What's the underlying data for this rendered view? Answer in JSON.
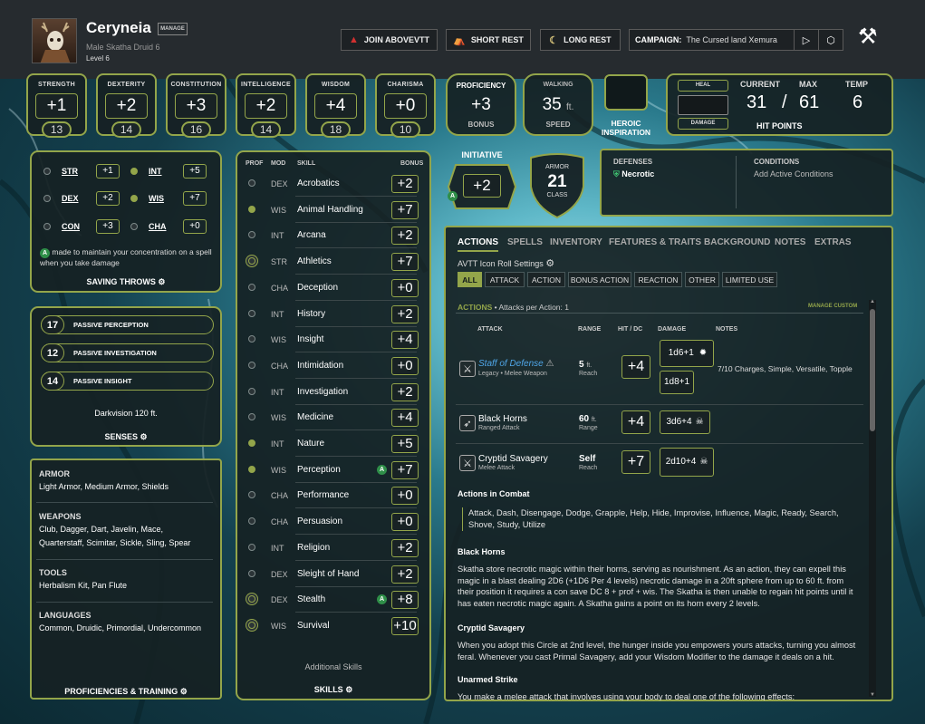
{
  "header": {
    "name": "Ceryneia",
    "manage": "MANAGE",
    "sub": "Male  Skatha  Druid 6",
    "level": "Level 6",
    "join": "JOIN ABOVEVTT",
    "short_rest": "SHORT REST",
    "long_rest": "LONG REST",
    "campaign_label": "CAMPAIGN:",
    "campaign": "The Cursed land Xemura"
  },
  "abilities": [
    {
      "name": "STRENGTH",
      "mod": "+1",
      "score": "13"
    },
    {
      "name": "DEXTERITY",
      "mod": "+2",
      "score": "14"
    },
    {
      "name": "CONSTITUTION",
      "mod": "+3",
      "score": "16"
    },
    {
      "name": "INTELLIGENCE",
      "mod": "+2",
      "score": "14"
    },
    {
      "name": "WISDOM",
      "mod": "+4",
      "score": "18"
    },
    {
      "name": "CHARISMA",
      "mod": "+0",
      "score": "10"
    }
  ],
  "proficiency": {
    "label": "PROFICIENCY",
    "value": "+3",
    "sub": "BONUS"
  },
  "walking": {
    "label": "WALKING",
    "value": "35",
    "unit": "ft.",
    "sub": "SPEED"
  },
  "inspiration": {
    "line1": "HEROIC",
    "line2": "INSPIRATION"
  },
  "hp": {
    "heal": "HEAL",
    "damage": "DAMAGE",
    "current_label": "CURRENT",
    "max_label": "MAX",
    "temp_label": "TEMP",
    "current": "31",
    "slash": "/",
    "max": "61",
    "temp": "6",
    "title": "HIT POINTS"
  },
  "initiative": {
    "label": "INITIATIVE",
    "value": "+2"
  },
  "armor": {
    "l1": "ARMOR",
    "value": "21",
    "l2": "CLASS"
  },
  "defenses": {
    "title": "DEFENSES",
    "item": "Necrotic"
  },
  "conditions": {
    "title": "CONDITIONS",
    "placeholder": "Add Active Conditions"
  },
  "saves": [
    {
      "name": "STR",
      "val": "+1",
      "prof": false
    },
    {
      "name": "INT",
      "val": "+5",
      "prof": true
    },
    {
      "name": "DEX",
      "val": "+2",
      "prof": false
    },
    {
      "name": "WIS",
      "val": "+7",
      "prof": true
    },
    {
      "name": "CON",
      "val": "+3",
      "prof": false
    },
    {
      "name": "CHA",
      "val": "+0",
      "prof": false
    }
  ],
  "saves_note": "made to maintain your concentration on a spell when you take damage",
  "saves_title": "SAVING THROWS",
  "passives": [
    {
      "val": "17",
      "label": "PASSIVE PERCEPTION"
    },
    {
      "val": "12",
      "label": "PASSIVE INVESTIGATION"
    },
    {
      "val": "14",
      "label": "PASSIVE INSIGHT"
    }
  ],
  "senses": {
    "darkvision": "Darkvision 120 ft.",
    "title": "SENSES"
  },
  "proficiencies": {
    "armor_h": "ARMOR",
    "armor": "Light Armor, Medium Armor, Shields",
    "weapons_h": "WEAPONS",
    "weapons": "Club, Dagger, Dart, Javelin, Mace, Quarterstaff, Scimitar, Sickle, Sling, Spear",
    "tools_h": "TOOLS",
    "tools": "Herbalism Kit, Pan Flute",
    "languages_h": "LANGUAGES",
    "languages": "Common, Druidic, Primordial, Undercommon",
    "title": "PROFICIENCIES & TRAINING"
  },
  "skills_head": {
    "prof": "PROF",
    "mod": "MOD",
    "skill": "SKILL",
    "bonus": "BONUS"
  },
  "skills": [
    {
      "a": "DEX",
      "n": "Acrobatics",
      "b": "+2",
      "p": "none",
      "g": false
    },
    {
      "a": "WIS",
      "n": "Animal Handling",
      "b": "+7",
      "p": "prof",
      "g": false
    },
    {
      "a": "INT",
      "n": "Arcana",
      "b": "+2",
      "p": "none",
      "g": false
    },
    {
      "a": "STR",
      "n": "Athletics",
      "b": "+7",
      "p": "expert",
      "g": false
    },
    {
      "a": "CHA",
      "n": "Deception",
      "b": "+0",
      "p": "none",
      "g": false
    },
    {
      "a": "INT",
      "n": "History",
      "b": "+2",
      "p": "none",
      "g": false
    },
    {
      "a": "WIS",
      "n": "Insight",
      "b": "+4",
      "p": "none",
      "g": false
    },
    {
      "a": "CHA",
      "n": "Intimidation",
      "b": "+0",
      "p": "none",
      "g": false
    },
    {
      "a": "INT",
      "n": "Investigation",
      "b": "+2",
      "p": "none",
      "g": false
    },
    {
      "a": "WIS",
      "n": "Medicine",
      "b": "+4",
      "p": "none",
      "g": false
    },
    {
      "a": "INT",
      "n": "Nature",
      "b": "+5",
      "p": "prof",
      "g": false
    },
    {
      "a": "WIS",
      "n": "Perception",
      "b": "+7",
      "p": "prof",
      "g": true
    },
    {
      "a": "CHA",
      "n": "Performance",
      "b": "+0",
      "p": "none",
      "g": false
    },
    {
      "a": "CHA",
      "n": "Persuasion",
      "b": "+0",
      "p": "none",
      "g": false
    },
    {
      "a": "INT",
      "n": "Religion",
      "b": "+2",
      "p": "none",
      "g": false
    },
    {
      "a": "DEX",
      "n": "Sleight of Hand",
      "b": "+2",
      "p": "none",
      "g": false
    },
    {
      "a": "DEX",
      "n": "Stealth",
      "b": "+8",
      "p": "expert",
      "g": true
    },
    {
      "a": "WIS",
      "n": "Survival",
      "b": "+10",
      "p": "expert",
      "g": false
    }
  ],
  "skills_footer": {
    "additional": "Additional Skills",
    "title": "SKILLS"
  },
  "tabs": [
    "ACTIONS",
    "SPELLS",
    "INVENTORY",
    "FEATURES & TRAITS",
    "BACKGROUND",
    "NOTES",
    "EXTRAS"
  ],
  "roll_settings": "AVTT Icon Roll Settings",
  "filters": [
    "ALL",
    "ATTACK",
    "ACTION",
    "BONUS ACTION",
    "REACTION",
    "OTHER",
    "LIMITED USE"
  ],
  "actions_head": {
    "title": "ACTIONS",
    "per": "• Attacks per Action: 1",
    "manage": "MANAGE CUSTOM",
    "attack": "ATTACK",
    "range": "RANGE",
    "hit": "HIT / DC",
    "damage": "DAMAGE",
    "notes": "NOTES"
  },
  "attacks": [
    {
      "name": "Staff of Defense",
      "sub": "Legacy • Melee Weapon",
      "range": "5",
      "range_unit": "ft.",
      "range_sub": "Reach",
      "hit": "+4",
      "dmg1": "1d6+1",
      "dmg2": "1d8+1",
      "notes": "7/10 Charges, Simple, Versatile, Topple"
    },
    {
      "name": "Black Horns",
      "sub": "Ranged Attack",
      "range": "60",
      "range_unit": "ft.",
      "range_sub": "Range",
      "hit": "+4",
      "dmg1": "3d6+4",
      "notes": ""
    },
    {
      "name": "Cryptid Savagery",
      "sub": "Melee Attack",
      "range": "Self",
      "range_sub": "Reach",
      "hit": "+7",
      "dmg1": "2d10+4",
      "notes": ""
    }
  ],
  "combat": {
    "title": "Actions in Combat",
    "list": "Attack, Dash, Disengage, Dodge, Grapple, Help, Hide, Improvise, Influence, Magic, Ready, Search, Shove, Study, Utilize"
  },
  "features": [
    {
      "title": "Black Horns",
      "text": "Skatha store necrotic magic within their horns, serving as nourishment. As an action, they can expell this magic in a blast dealing 2D6 (+1D6 Per 4 levels) necrotic damage in a 20ft sphere from up to 60 ft. from their position it requires a con save DC 8 + prof + wis. The Skatha is then unable to regain hit points until it has eaten necrotic magic again. A Skatha gains a point on its horn every 2 levels."
    },
    {
      "title": "Cryptid Savagery",
      "text": "When you adopt this Circle at 2nd level, the hunger inside you empowers yours attacks, turning you almost feral. Whenever you cast Primal Savagery, add your Wisdom Modifier to the damage it deals on a hit."
    },
    {
      "title": "Unarmed Strike",
      "text": "You make a melee attack that involves using your body to deal one of the following effects:"
    }
  ]
}
